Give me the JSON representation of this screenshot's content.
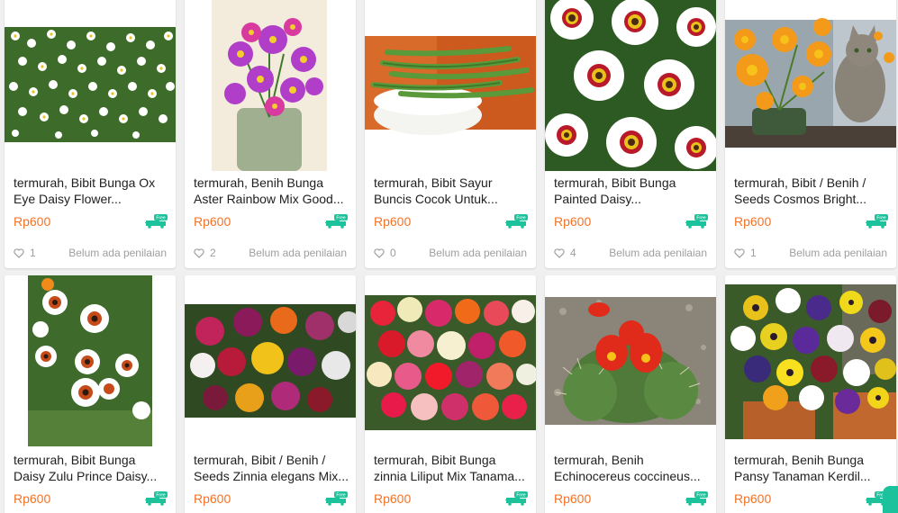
{
  "colors": {
    "price": "#f57224",
    "free_badge": "#1cc29b",
    "text": "#212121",
    "muted": "#9e9e9e"
  },
  "icons": {
    "free": "free-shipping-truck-icon",
    "like": "heart-icon"
  },
  "products": [
    {
      "title": "termurah, Bibit Bunga Ox Eye Daisy Flower...",
      "price": "Rp600",
      "free": "Free",
      "likes": "1",
      "rating": "Belum ada penilaian",
      "image": "white daisy field"
    },
    {
      "title": "termurah, Benih Bunga Aster Rainbow Mix Good...",
      "price": "Rp600",
      "free": "Free",
      "likes": "2",
      "rating": "Belum ada penilaian",
      "image": "purple aster bouquet"
    },
    {
      "title": "termurah, Bibit Sayur Buncis Cocok Untuk...",
      "price": "Rp600",
      "free": "Free",
      "likes": "0",
      "rating": "Belum ada penilaian",
      "image": "green beans in bowl"
    },
    {
      "title": "termurah, Bibit Bunga Painted Daisy...",
      "price": "Rp600",
      "free": "Free",
      "likes": "4",
      "rating": "Belum ada penilaian",
      "image": "painted daisy closeup"
    },
    {
      "title": "termurah, Bibit / Benih / Seeds Cosmos Bright...",
      "price": "Rp600",
      "free": "Free",
      "likes": "1",
      "rating": "Belum ada penilaian",
      "image": "orange cosmos with cat"
    },
    {
      "title": "termurah, Bibit Bunga Daisy Zulu Prince Daisy...",
      "price": "Rp600",
      "free": "Free",
      "image": "zulu prince daisy"
    },
    {
      "title": "termurah, Bibit / Benih / Seeds Zinnia elegans Mix...",
      "price": "Rp600",
      "free": "Free",
      "image": "zinnia elegans mix"
    },
    {
      "title": "termurah, Bibit Bunga zinnia Liliput Mix Tanama...",
      "price": "Rp600",
      "free": "Free",
      "image": "zinnia liliput mix"
    },
    {
      "title": "termurah, Benih Echinocereus coccineus...",
      "price": "Rp600",
      "free": "Free",
      "image": "red cactus flower"
    },
    {
      "title": "termurah, Benih Bunga Pansy Tanaman Kerdil...",
      "price": "Rp600",
      "free": "Free",
      "image": "pansy flowers in pots"
    }
  ]
}
